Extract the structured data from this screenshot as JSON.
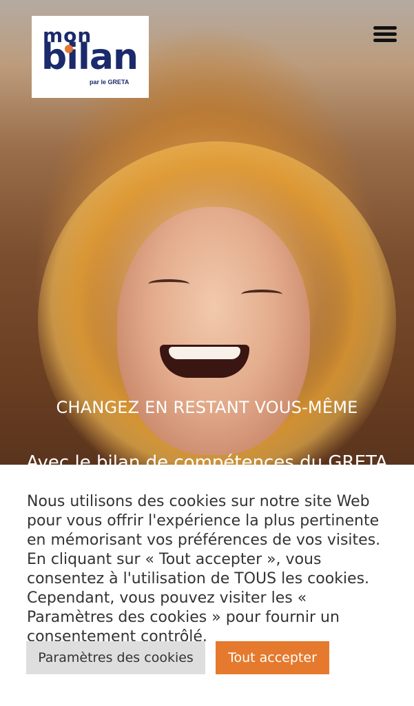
{
  "header": {
    "logo": {
      "line1": "mon",
      "line2": "bilan",
      "sub": "par le GRETA"
    },
    "menu_icon": "hamburger-menu-icon"
  },
  "hero": {
    "headline": "CHANGEZ EN RESTANT VOUS-MÊME",
    "subline": "Avec le bilan de compétences du GRETA"
  },
  "cookie_banner": {
    "message": "Nous utilisons des cookies sur notre site Web pour vous offrir l'expérience la plus pertinente en mémorisant vos préférences de vos visites. En cliquant sur « Tout accepter », vous consentez à l'utilisation de TOUS les cookies. Cependant, vous pouvez visiter les « Paramètres des cookies » pour fournir un consentement contrôlé.",
    "settings_label": "Paramètres des cookies",
    "accept_label": "Tout accepter"
  },
  "colors": {
    "brand_blue": "#1b2a6b",
    "accent_orange": "#e57a2f",
    "button_grey": "#dedede"
  }
}
